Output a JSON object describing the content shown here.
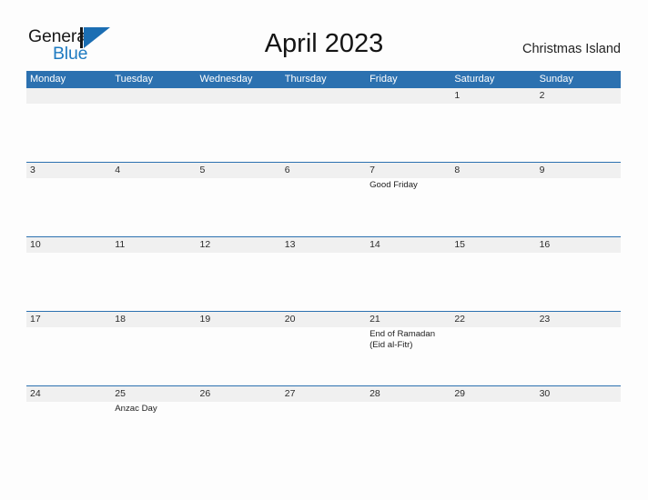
{
  "brand": {
    "name_part1": "General",
    "name_part2": "Blue",
    "logo_icon": "triangle-flag-icon",
    "accent_color": "#1B6EB3"
  },
  "header": {
    "title": "April 2023",
    "region": "Christmas Island"
  },
  "colors": {
    "header_blue": "#2C71B0",
    "date_band_gray": "#F0F0F0",
    "page_background": "#FDFDFD",
    "text": "#222222",
    "logo_blue": "#1F7BC1"
  },
  "calendar": {
    "weekdays": [
      "Monday",
      "Tuesday",
      "Wednesday",
      "Thursday",
      "Friday",
      "Saturday",
      "Sunday"
    ],
    "weeks": [
      {
        "days": [
          {
            "date": "",
            "events": []
          },
          {
            "date": "",
            "events": []
          },
          {
            "date": "",
            "events": []
          },
          {
            "date": "",
            "events": []
          },
          {
            "date": "",
            "events": []
          },
          {
            "date": "1",
            "events": []
          },
          {
            "date": "2",
            "events": []
          }
        ]
      },
      {
        "days": [
          {
            "date": "3",
            "events": []
          },
          {
            "date": "4",
            "events": []
          },
          {
            "date": "5",
            "events": []
          },
          {
            "date": "6",
            "events": []
          },
          {
            "date": "7",
            "events": [
              "Good Friday"
            ]
          },
          {
            "date": "8",
            "events": []
          },
          {
            "date": "9",
            "events": []
          }
        ]
      },
      {
        "days": [
          {
            "date": "10",
            "events": []
          },
          {
            "date": "11",
            "events": []
          },
          {
            "date": "12",
            "events": []
          },
          {
            "date": "13",
            "events": []
          },
          {
            "date": "14",
            "events": []
          },
          {
            "date": "15",
            "events": []
          },
          {
            "date": "16",
            "events": []
          }
        ]
      },
      {
        "days": [
          {
            "date": "17",
            "events": []
          },
          {
            "date": "18",
            "events": []
          },
          {
            "date": "19",
            "events": []
          },
          {
            "date": "20",
            "events": []
          },
          {
            "date": "21",
            "events": [
              "End of Ramadan",
              "(Eid al-Fitr)"
            ]
          },
          {
            "date": "22",
            "events": []
          },
          {
            "date": "23",
            "events": []
          }
        ]
      },
      {
        "days": [
          {
            "date": "24",
            "events": []
          },
          {
            "date": "25",
            "events": [
              "Anzac Day"
            ]
          },
          {
            "date": "26",
            "events": []
          },
          {
            "date": "27",
            "events": []
          },
          {
            "date": "28",
            "events": []
          },
          {
            "date": "29",
            "events": []
          },
          {
            "date": "30",
            "events": []
          }
        ]
      }
    ]
  }
}
